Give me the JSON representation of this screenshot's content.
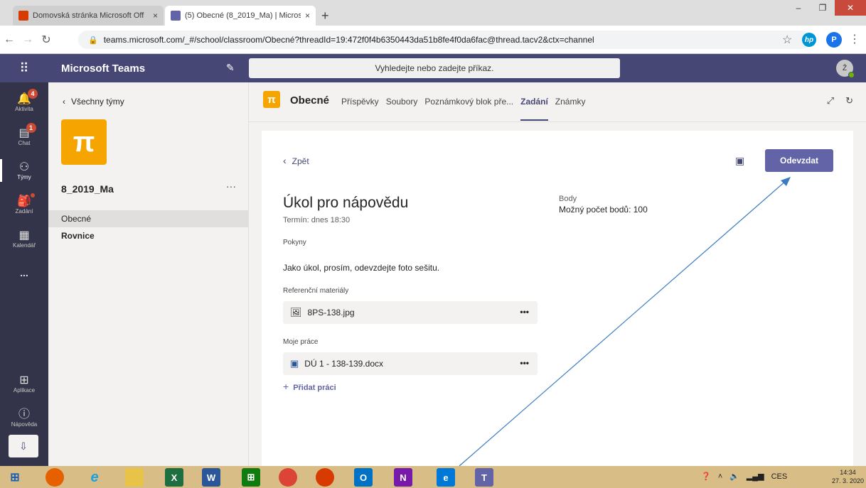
{
  "browser": {
    "tabs": [
      {
        "title": "Domovská stránka Microsoft Off",
        "active": false
      },
      {
        "title": "(5) Obecné (8_2019_Ma) | Micros",
        "active": true
      }
    ],
    "close_glyph": "×",
    "new_tab_glyph": "+",
    "window_controls": {
      "minimize": "–",
      "maximize": "❐",
      "close": "✕"
    },
    "url": "teams.microsoft.com/_#/school/classroom/Obecné?threadId=19:472f0f4b6350443da51b8fe4f0da6fac@thread.tacv2&ctx=channel",
    "profile_initial": "P",
    "hp_label": "hp"
  },
  "teams": {
    "app_name": "Microsoft Teams",
    "search_placeholder": "Vyhledejte nebo zadejte příkaz.",
    "avatar_initial": "Ž"
  },
  "rail": {
    "items": [
      {
        "label": "Aktivita",
        "icon": "bell-icon",
        "badge": "4"
      },
      {
        "label": "Chat",
        "icon": "chat-icon",
        "badge": "1"
      },
      {
        "label": "Týmy",
        "icon": "teams-icon"
      },
      {
        "label": "Zadání",
        "icon": "assignment-icon"
      },
      {
        "label": "Kalendář",
        "icon": "calendar-icon"
      },
      {
        "label": "...",
        "icon": "more-icon"
      },
      {
        "label": "Aplikace",
        "icon": "apps-icon"
      },
      {
        "label": "Nápověda",
        "icon": "help-icon"
      }
    ]
  },
  "team_panel": {
    "back_label": "Všechny týmy",
    "team_name": "8_2019_Ma",
    "team_logo": "π",
    "more": "···",
    "channels": [
      "Obecné",
      "Rovnice"
    ]
  },
  "channel": {
    "name": "Obecné",
    "logo": "π",
    "tabs": [
      "Příspěvky",
      "Soubory",
      "Poznámkový blok pře...",
      "Zadání",
      "Známky"
    ],
    "active_tab": "Zadání"
  },
  "assignment": {
    "back_label": "Zpět",
    "submit_label": "Odevzdat",
    "title": "Úkol pro nápovědu",
    "due": "Termín: dnes 18:30",
    "points_label": "Body",
    "points_value": "Možný počet bodů: 100",
    "instructions_label": "Pokyny",
    "instructions": "Jako úkol, prosím, odevzdejte foto sešitu.",
    "reference_label": "Referenční materiály",
    "reference_file": "8PS-138.jpg",
    "my_work_label": "Moje práce",
    "my_work_file": "DÚ 1 - 138-139.docx",
    "add_work_label": "Přidat práci",
    "item_more": "•••"
  },
  "taskbar": {
    "apps": [
      "windows-start-icon",
      "firefox-icon",
      "ie-icon",
      "file-explorer-icon",
      "excel-icon",
      "word-icon",
      "store-icon",
      "chrome-icon",
      "app-icon",
      "outlook-icon",
      "onenote-icon",
      "edge-icon",
      "teams-icon"
    ],
    "tray_lang": "CES",
    "clock_time": "14:34",
    "clock_date": "27. 3. 2020"
  },
  "colors": {
    "teams_purple": "#464775",
    "accent": "#6264a7",
    "team_orange": "#f6a500",
    "badge_red": "#cc4a31",
    "annotation_arrow": "#3a7bbf"
  }
}
